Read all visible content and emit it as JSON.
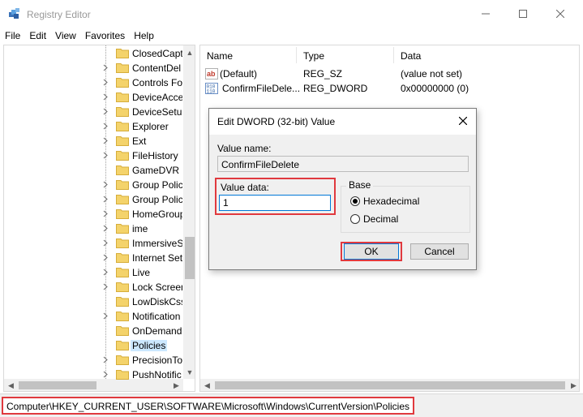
{
  "window": {
    "title": "Registry Editor"
  },
  "menu": [
    "File",
    "Edit",
    "View",
    "Favorites",
    "Help"
  ],
  "tree": {
    "items": [
      {
        "label": "ClosedCapt",
        "expandable": false
      },
      {
        "label": "ContentDel",
        "expandable": true
      },
      {
        "label": "Controls Fo",
        "expandable": true
      },
      {
        "label": "DeviceAcce",
        "expandable": true
      },
      {
        "label": "DeviceSetup",
        "expandable": true
      },
      {
        "label": "Explorer",
        "expandable": true
      },
      {
        "label": "Ext",
        "expandable": true
      },
      {
        "label": "FileHistory",
        "expandable": true
      },
      {
        "label": "GameDVR",
        "expandable": false
      },
      {
        "label": "Group Polic",
        "expandable": true
      },
      {
        "label": "Group Polic",
        "expandable": true
      },
      {
        "label": "HomeGroup",
        "expandable": true
      },
      {
        "label": "ime",
        "expandable": true
      },
      {
        "label": "ImmersiveS",
        "expandable": true
      },
      {
        "label": "Internet Set",
        "expandable": true
      },
      {
        "label": "Live",
        "expandable": true
      },
      {
        "label": "Lock Screen",
        "expandable": true
      },
      {
        "label": "LowDiskCss",
        "expandable": false
      },
      {
        "label": "Notification",
        "expandable": true
      },
      {
        "label": "OnDemand",
        "expandable": false
      },
      {
        "label": "Policies",
        "expandable": false,
        "selected": true
      },
      {
        "label": "PrecisionTo",
        "expandable": true
      },
      {
        "label": "PushNotific",
        "expandable": true
      }
    ]
  },
  "list": {
    "columns": [
      "Name",
      "Type",
      "Data"
    ],
    "rows": [
      {
        "icon": "string-value-icon",
        "name": "(Default)",
        "type": "REG_SZ",
        "data": "(value not set)"
      },
      {
        "icon": "binary-value-icon",
        "name": "ConfirmFileDele...",
        "type": "REG_DWORD",
        "data": "0x00000000 (0)"
      }
    ]
  },
  "dialog": {
    "title": "Edit DWORD (32-bit) Value",
    "value_name_label": "Value name:",
    "value_name": "ConfirmFileDelete",
    "value_data_label": "Value data:",
    "value_data": "1",
    "base_label": "Base",
    "radio_hex": "Hexadecimal",
    "radio_dec": "Decimal",
    "selected_base": "Hexadecimal",
    "ok_label": "OK",
    "cancel_label": "Cancel"
  },
  "status": {
    "path": "Computer\\HKEY_CURRENT_USER\\SOFTWARE\\Microsoft\\Windows\\CurrentVersion\\Policies"
  },
  "colors": {
    "highlight_box": "#e0393e",
    "selection": "#cce8ff",
    "folder": "#f4d36b",
    "focus": "#0078d7"
  }
}
